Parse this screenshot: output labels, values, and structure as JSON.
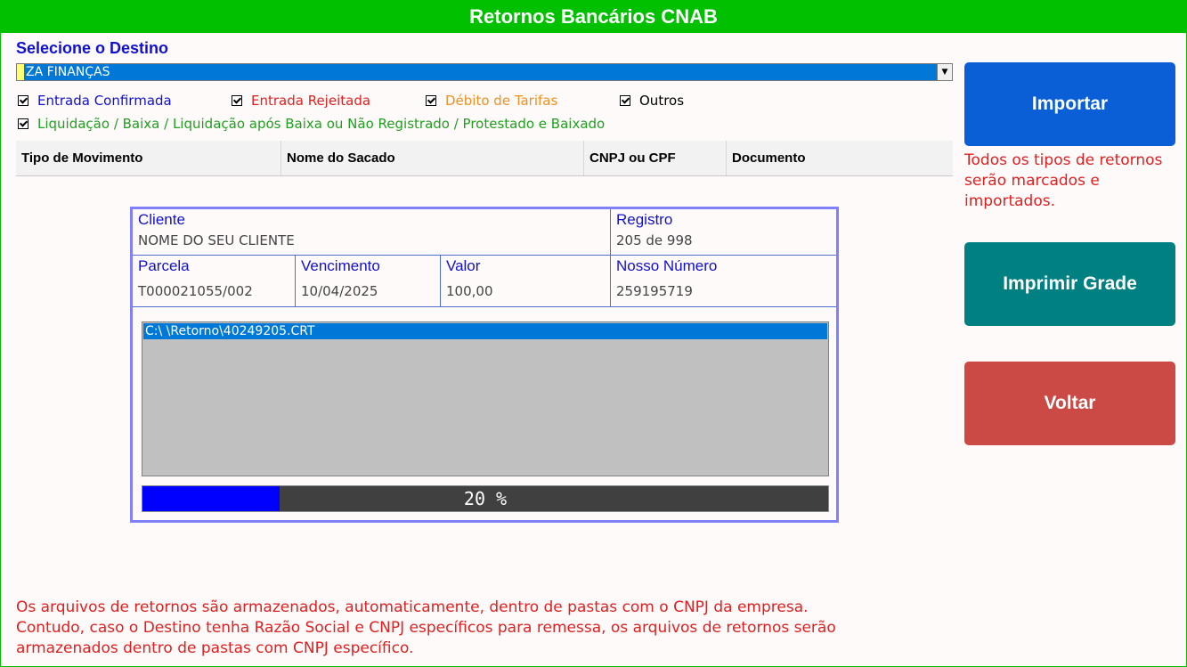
{
  "title": "Retornos Bancários CNAB",
  "destino": {
    "label": "Selecione o Destino",
    "value": "ZA FINANÇAS"
  },
  "filters": [
    {
      "label": "Entrada Confirmada",
      "color": "#1010d0",
      "checked": true
    },
    {
      "label": "Entrada Rejeitada",
      "color": "#e02020",
      "checked": true
    },
    {
      "label": "Débito de Tarifas",
      "color": "#f09020",
      "checked": true
    },
    {
      "label": "Outros",
      "color": "#000000",
      "checked": true
    },
    {
      "label": "Liquidação / Baixa / Liquidação após Baixa ou Não Registrado / Protestado e Baixado",
      "color": "#20a020",
      "checked": true
    }
  ],
  "grid": {
    "columns": [
      "Tipo de Movimento",
      "Nome do Sacado",
      "CNPJ ou CPF",
      "Documento"
    ]
  },
  "details": {
    "cliente_label": "Cliente",
    "cliente_value": "NOME DO SEU CLIENTE",
    "registro_label": "Registro",
    "registro_value": "205 de 998",
    "parcela_label": "Parcela",
    "parcela_value": "T000021055/002",
    "vencimento_label": "Vencimento",
    "vencimento_value": "10/04/2025",
    "valor_label": "Valor",
    "valor_value": "100,00",
    "nosso_label": "Nosso Número",
    "nosso_value": "259195719"
  },
  "files": [
    "C:\\          \\Retorno\\40249205.CRT"
  ],
  "progress": {
    "percent": 20,
    "label": "20 %"
  },
  "buttons": {
    "importar": "Importar",
    "imprimir": "Imprimir Grade",
    "voltar": "Voltar"
  },
  "colors": {
    "title_bar": "#00c000",
    "importar": "#0a5fd6",
    "imprimir": "#008080",
    "voltar": "#cc4a45"
  },
  "notes": {
    "importar_hint": "Todos os tipos de retornos serão marcados e importados.",
    "storage_line1": "Os arquivos de retornos são armazenados, automaticamente, dentro de pastas com o CNPJ da empresa.",
    "storage_line2": "Contudo, caso o Destino tenha Razão Social e CNPJ específicos para remessa, os arquivos de retornos serão",
    "storage_line3": "armazenados dentro de pastas com CNPJ específico."
  }
}
